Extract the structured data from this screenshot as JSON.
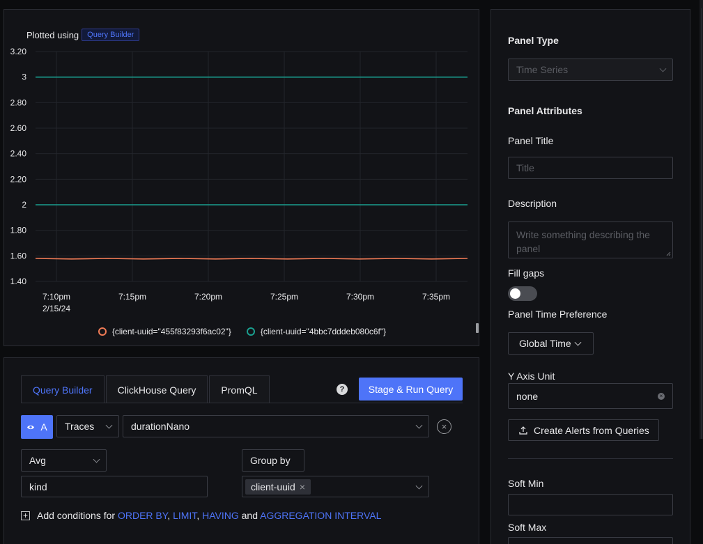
{
  "chart": {
    "plotted_label": "Plotted using",
    "badge": "Query Builder"
  },
  "chart_data": {
    "type": "line",
    "y_ticks": [
      "3.20",
      "3",
      "2.80",
      "2.60",
      "2.40",
      "2.20",
      "2",
      "1.80",
      "1.60",
      "1.40"
    ],
    "ylim": [
      1.4,
      3.2
    ],
    "x_ticks": [
      "7:10pm",
      "7:15pm",
      "7:20pm",
      "7:25pm",
      "7:30pm",
      "7:35pm"
    ],
    "x_date": "2/15/24",
    "series": [
      {
        "name": "{client-uuid=\"455f83293f6ac02\"}",
        "color": "#f07b56",
        "values": [
          1.58,
          1.58,
          1.58,
          1.58,
          1.58,
          1.58,
          1.58
        ]
      },
      {
        "name": "{client-uuid=\"4bbc7dddeb080c6f\"}",
        "color": "#1a9f8f",
        "values": [
          3,
          3,
          3,
          3,
          3,
          3,
          3
        ],
        "secondary_values": [
          2,
          2,
          2,
          2,
          2,
          2,
          2
        ]
      }
    ],
    "grid": true,
    "legend_position": "bottom-center"
  },
  "query": {
    "tabs": [
      "Query Builder",
      "ClickHouse Query",
      "PromQL"
    ],
    "help": "?",
    "run_button": "Stage & Run Query",
    "query_name": "A",
    "data_source": "Traces",
    "attribute": "durationNano",
    "aggregate": "Avg",
    "group_by_label": "Group by",
    "filter_value": "kind",
    "group_by_tag": "client-uuid",
    "tag_remove": "×",
    "remove_query": "×",
    "add_conditions_prefix": "Add conditions for",
    "order_by": "ORDER BY",
    "limit": "LIMIT",
    "having": "HAVING",
    "and_word": "and",
    "agg_interval": "AGGREGATION INTERVAL",
    "comma": ","
  },
  "right": {
    "panel_type_label": "Panel Type",
    "panel_type_value": "Time Series",
    "panel_attributes": "Panel Attributes",
    "panel_title_label": "Panel Title",
    "panel_title_placeholder": "Title",
    "description_label": "Description",
    "description_placeholder": "Write something describing the panel",
    "fill_gaps_label": "Fill gaps",
    "time_pref_label": "Panel Time Preference",
    "time_pref_value": "Global Time",
    "y_axis_label": "Y Axis Unit",
    "y_axis_value": "none",
    "create_alerts": "Create Alerts from Queries",
    "soft_min_label": "Soft Min",
    "soft_max_label": "Soft Max"
  }
}
